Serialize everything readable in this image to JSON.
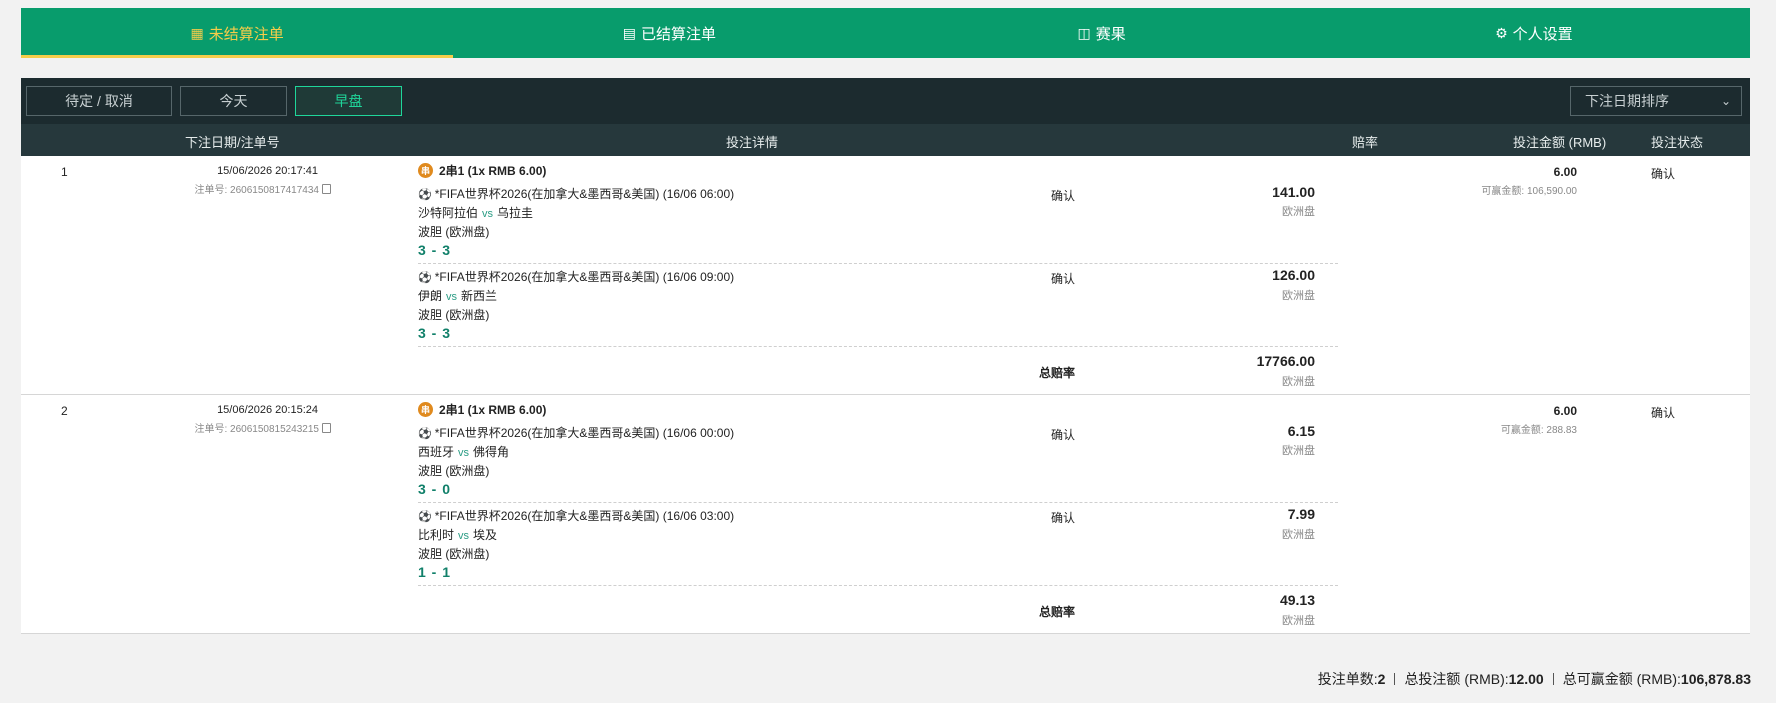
{
  "nav": {
    "tabs": [
      {
        "label": "未结算注单",
        "icon": "ledger-icon"
      },
      {
        "label": "已结算注单",
        "icon": "settled-icon"
      },
      {
        "label": "赛果",
        "icon": "scoreboard-icon"
      },
      {
        "label": "个人设置",
        "icon": "gear-icon"
      }
    ]
  },
  "filters": {
    "buttons": [
      "待定 / 取消",
      "今天",
      "早盘"
    ],
    "sort": "下注日期排序"
  },
  "columns": {
    "date_id": "下注日期/注单号",
    "detail": "投注详情",
    "odds": "赔率",
    "stake": "投注金额 (RMB)",
    "status": "投注状态"
  },
  "bets": [
    {
      "index": "1",
      "datetime": "15/06/2026 20:17:41",
      "order_label": "注单号: 2606150817417434",
      "header": "2串1 (1x RMB 6.00)",
      "chuan": "串",
      "stake": "6.00",
      "win_label": "可赢金额: 106,590.00",
      "status": "确认",
      "total_label": "总赔率",
      "total_odds": "17766.00",
      "total_market": "欧洲盘",
      "legs": [
        {
          "league": "*FIFA世界杯2026(在加拿大&墨西哥&美国) (16/06 06:00)",
          "home": "沙特阿拉伯",
          "vs": "vs",
          "away": "乌拉圭",
          "market": "波胆 (欧洲盘)",
          "pick": "3 - 3",
          "confirm": "确认",
          "odds": "141.00",
          "odds_market": "欧洲盘"
        },
        {
          "league": "*FIFA世界杯2026(在加拿大&墨西哥&美国) (16/06 09:00)",
          "home": "伊朗",
          "vs": "vs",
          "away": "新西兰",
          "market": "波胆 (欧洲盘)",
          "pick": "3 - 3",
          "confirm": "确认",
          "odds": "126.00",
          "odds_market": "欧洲盘"
        }
      ]
    },
    {
      "index": "2",
      "datetime": "15/06/2026 20:15:24",
      "order_label": "注单号: 2606150815243215",
      "header": "2串1 (1x RMB 6.00)",
      "chuan": "串",
      "stake": "6.00",
      "win_label": "可赢金额: 288.83",
      "status": "确认",
      "total_label": "总赔率",
      "total_odds": "49.13",
      "total_market": "欧洲盘",
      "legs": [
        {
          "league": "*FIFA世界杯2026(在加拿大&墨西哥&美国) (16/06 00:00)",
          "home": "西班牙",
          "vs": "vs",
          "away": "佛得角",
          "market": "波胆 (欧洲盘)",
          "pick": "3 - 0",
          "confirm": "确认",
          "odds": "6.15",
          "odds_market": "欧洲盘"
        },
        {
          "league": "*FIFA世界杯2026(在加拿大&墨西哥&美国) (16/06 03:00)",
          "home": "比利时",
          "vs": "vs",
          "away": "埃及",
          "market": "波胆 (欧洲盘)",
          "pick": "1 - 1",
          "confirm": "确认",
          "odds": "7.99",
          "odds_market": "欧洲盘"
        }
      ]
    }
  ],
  "summary": {
    "count_label": "投注单数:",
    "count": "2",
    "total_stake_label": "总投注额 (RMB):",
    "total_stake": "12.00",
    "total_win_label": "总可赢金额 (RMB):",
    "total_win": "106,878.83"
  },
  "colors": {
    "nav_bg": "#089c6c",
    "active_tab": "#f5cd4a",
    "score": "#11806a",
    "filter_bg": "#1c2b2f"
  }
}
